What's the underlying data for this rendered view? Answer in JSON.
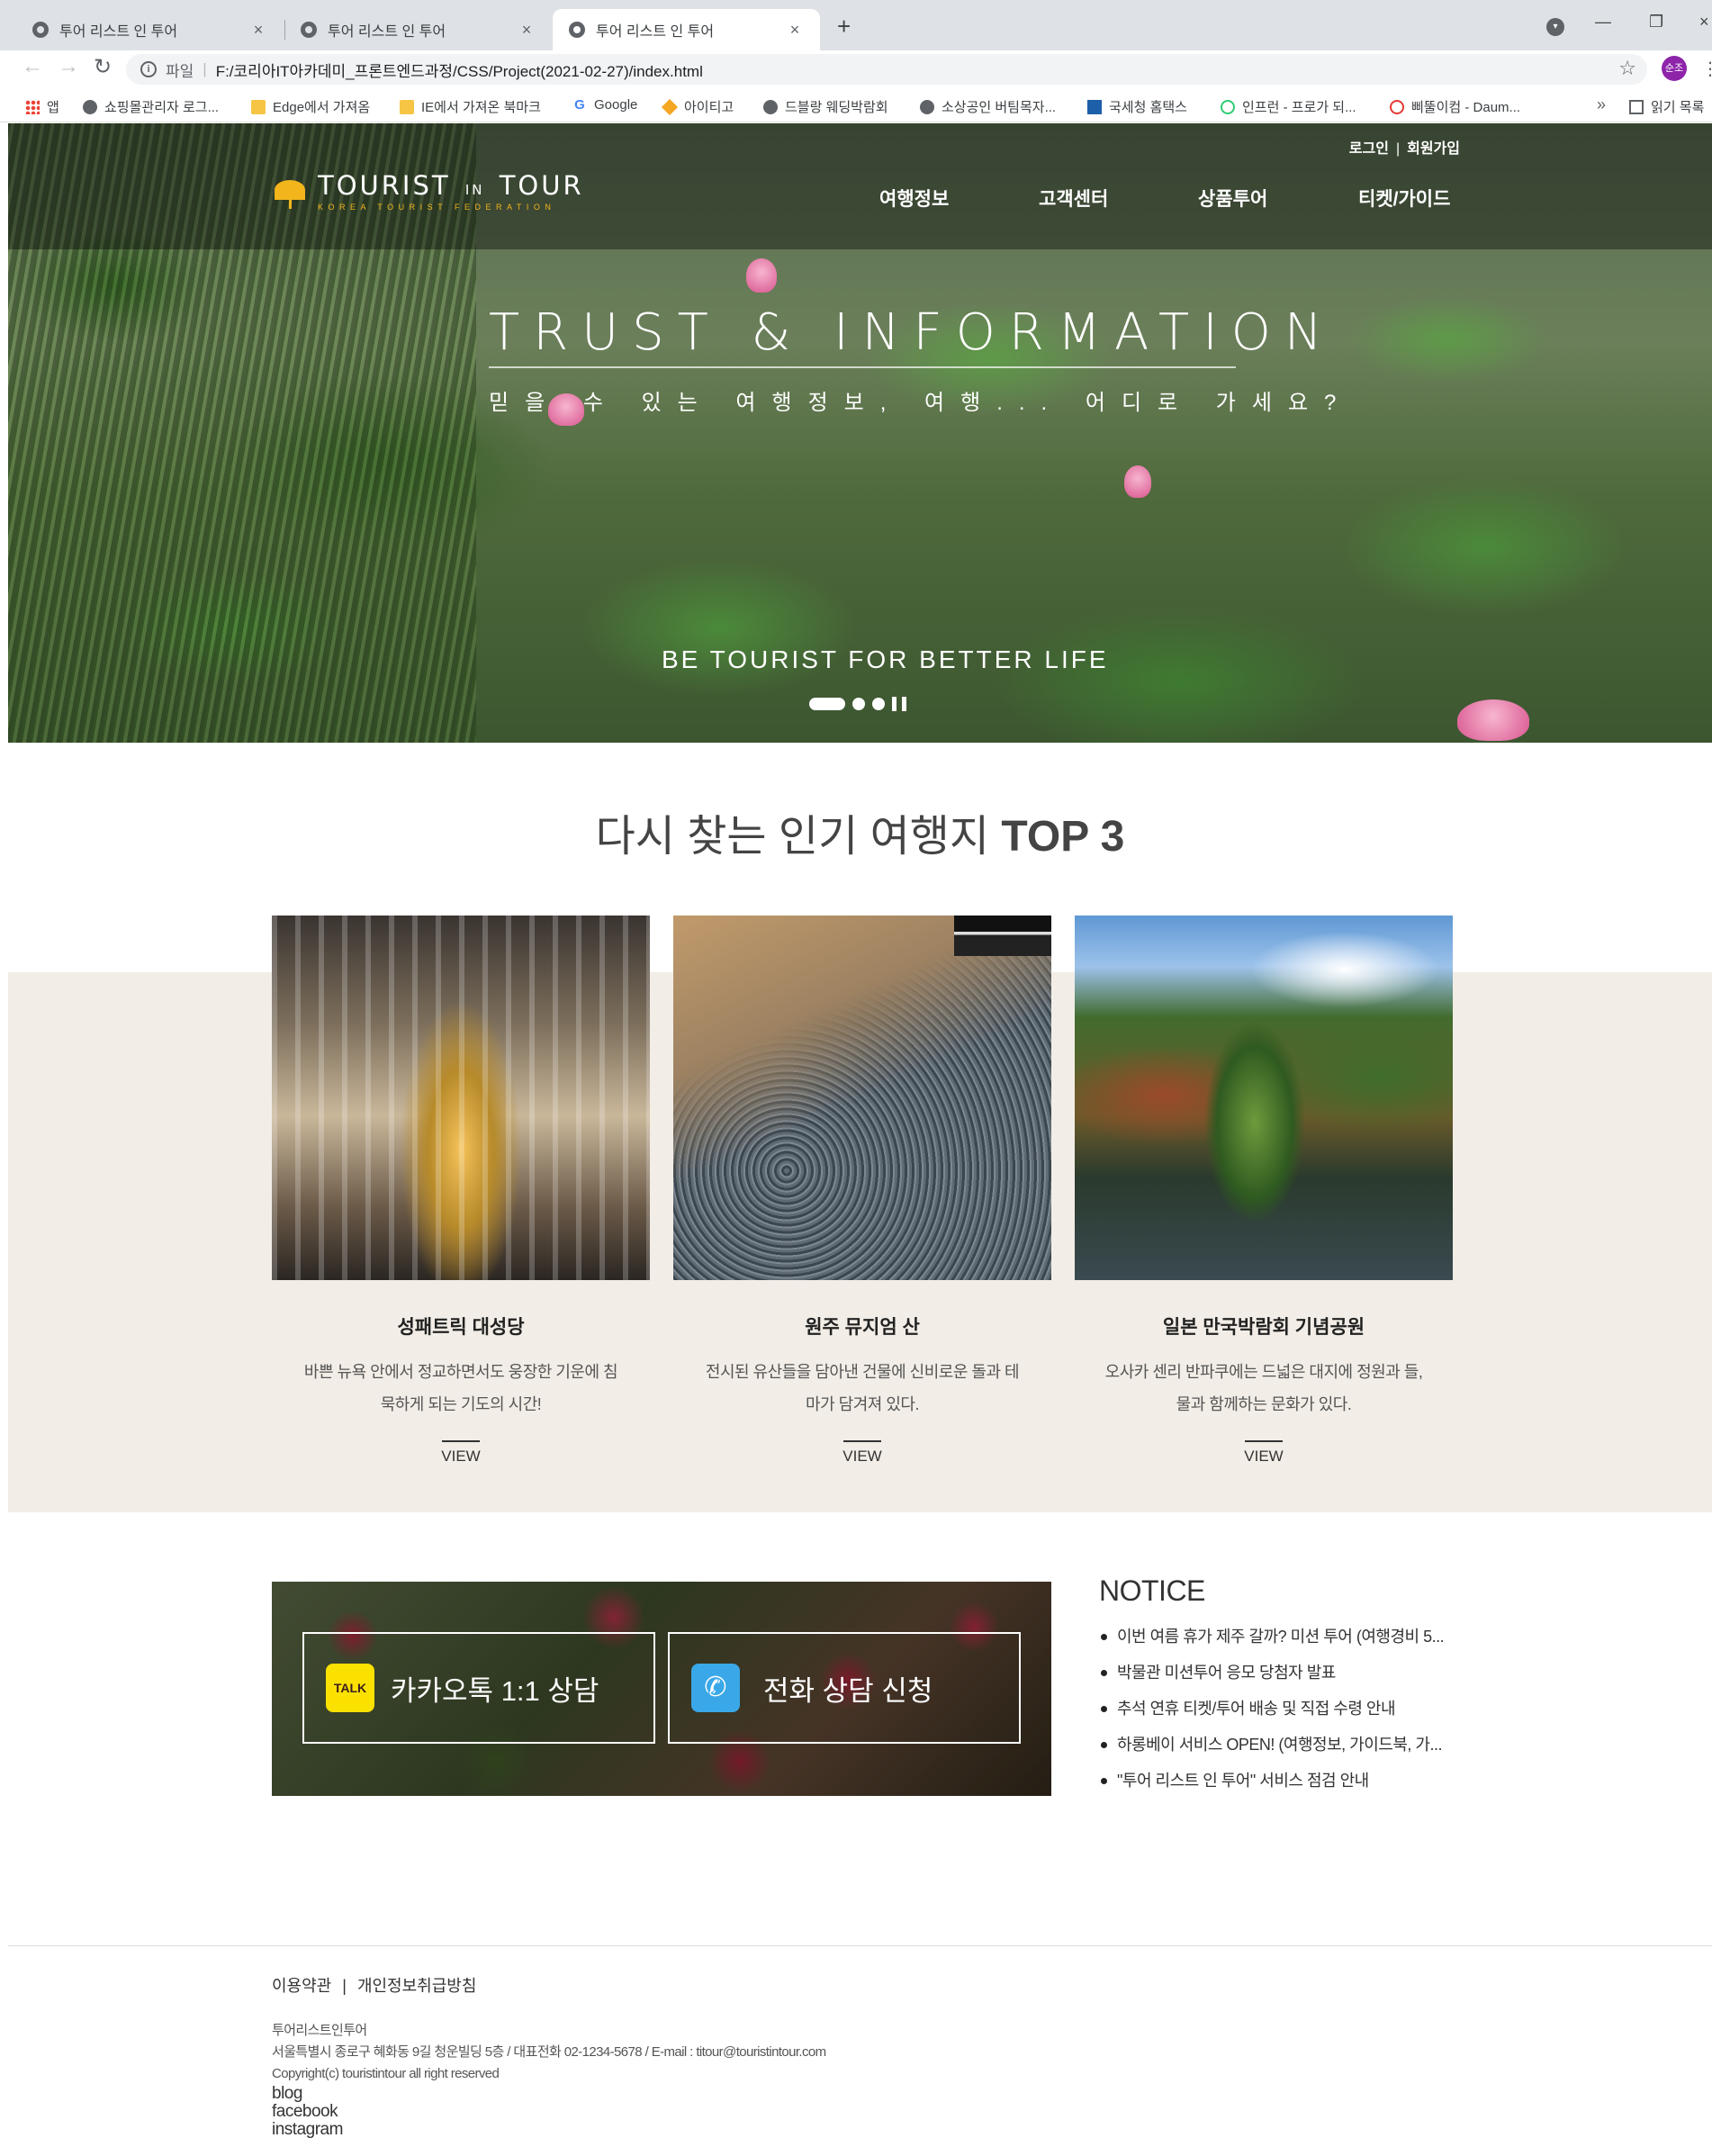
{
  "browser": {
    "tabs": [
      {
        "title": "투어 리스트 인 투어",
        "active": false
      },
      {
        "title": "투어 리스트 인 투어",
        "active": false
      },
      {
        "title": "투어 리스트 인 투어",
        "active": true
      }
    ],
    "new_tab": "+",
    "address": {
      "scheme": "파일",
      "url": "F:/코리아IT아카데미_프론트엔드과정/CSS/Project(2021-02-27)/index.html"
    },
    "profile_initials": "순조",
    "bookmarks": [
      {
        "label": "앱",
        "icon": "apps-icon"
      },
      {
        "label": "쇼핑몰관리자 로그...",
        "icon": "globe-icon"
      },
      {
        "label": "Edge에서 가져옴",
        "icon": "folder-icon"
      },
      {
        "label": "IE에서 가져온 북마크",
        "icon": "folder-icon"
      },
      {
        "label": "Google",
        "icon": "google-icon"
      },
      {
        "label": "아이티고",
        "icon": "diamond-icon"
      },
      {
        "label": "드블랑 웨딩박람회",
        "icon": "globe-icon"
      },
      {
        "label": "소상공인 버팀목자...",
        "icon": "globe-icon"
      },
      {
        "label": "국세청 홈택스",
        "icon": "hometax-icon"
      },
      {
        "label": "인프런 - 프로가 되...",
        "icon": "inflearn-icon"
      },
      {
        "label": "삐뚤이컴 - Daum...",
        "icon": "daum-icon"
      }
    ],
    "bookmark_more": "»",
    "reading_list": "읽기 목록"
  },
  "site": {
    "logo": {
      "main_1": "TOURIST",
      "main_in": "IN",
      "main_2": "TOUR",
      "sub": "KOREA TOURIST FEDERATION"
    },
    "util": {
      "login": "로그인",
      "join": "회원가입",
      "sep": "|"
    },
    "gnb": [
      "여행정보",
      "고객센터",
      "상품투어",
      "티켓/가이드"
    ],
    "hero": {
      "title": "TRUST & INFORMATION",
      "subtitle": "믿을 수 있는 여행정보, 여행... 어디로 가세요?",
      "tagline": "BE TOURIST FOR BETTER LIFE",
      "slides": 3,
      "active_slide": 1
    },
    "top3": {
      "title_normal": "다시 찾는 인기 여행지",
      "title_bold": "TOP 3",
      "cards": [
        {
          "title": "성패트릭 대성당",
          "desc": "바쁜 뉴욕 안에서 정교하면서도 웅장한 기운에 침묵하게 되는 기도의 시간!",
          "view": "VIEW"
        },
        {
          "title": "원주 뮤지엄 산",
          "desc": "전시된 유산들을 담아낸 건물에 신비로운 돌과 테마가 담겨져 있다.",
          "view": "VIEW"
        },
        {
          "title": "일본 만국박람회 기념공원",
          "desc": "오사카 센리 반파쿠에는 드넓은 대지에 정원과 들, 물과 함께하는 문화가 있다.",
          "view": "VIEW"
        }
      ]
    },
    "consult": {
      "kakao_icon_text": "TALK",
      "kakao": "카카오톡 1:1 상담",
      "phone": "전화 상담 신청"
    },
    "notice": {
      "title": "NOTICE",
      "items": [
        "이번 여름 휴가 제주 갈까? 미션 투어 (여행경비 5...",
        "박물관 미션투어 응모 당첨자 발표",
        "추석 연휴 티켓/투어 배송 및 직접 수령 안내",
        "하롱베이 서비스 OPEN! (여행정보, 가이드북, 가...",
        "\"투어 리스트 인 투어\" 서비스 점검 안내"
      ]
    },
    "footer": {
      "terms": "이용약관",
      "privacy": "개인정보취급방침",
      "sep": "|",
      "company": "투어리스트인투어",
      "address": "서울특별시 종로구 혜화동 9길 청운빌딩 5층 / 대표전화 02-1234-5678 / E-mail : titour@touristintour.com",
      "copyright": "Copyright(c) touristintour all right reserved",
      "sns": [
        "blog",
        "facebook",
        "instagram"
      ]
    }
  }
}
